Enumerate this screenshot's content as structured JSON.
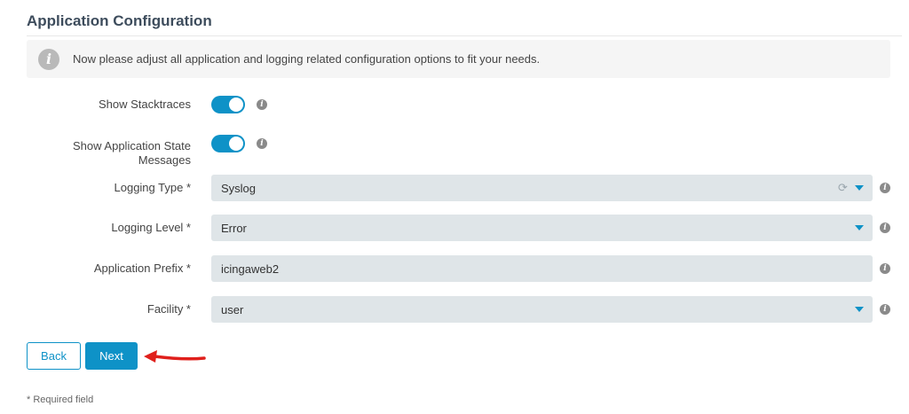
{
  "page": {
    "title": "Application Configuration"
  },
  "info": {
    "icon": "info-icon",
    "message": "Now please adjust all application and logging related configuration options to fit your needs."
  },
  "fields": {
    "show_stacktraces": {
      "label": "Show Stacktraces",
      "enabled": true
    },
    "show_app_state": {
      "label": "Show Application State Messages",
      "label_line1": "Show Application State",
      "label_line2": "Messages",
      "enabled": true
    },
    "logging_type": {
      "label": "Logging Type *",
      "value": "Syslog"
    },
    "logging_level": {
      "label": "Logging Level *",
      "value": "Error"
    },
    "application_prefix": {
      "label": "Application Prefix *",
      "value": "icingaweb2"
    },
    "facility": {
      "label": "Facility *",
      "value": "user"
    }
  },
  "buttons": {
    "back": "Back",
    "next": "Next"
  },
  "footer": {
    "required_note": "* Required field"
  },
  "colors": {
    "accent": "#0e92c7",
    "field_bg": "#dfe5e8",
    "arrow": "#e0201c"
  },
  "glyphs": {
    "info_big": "i",
    "info_small": "i",
    "refresh": "⟳"
  }
}
